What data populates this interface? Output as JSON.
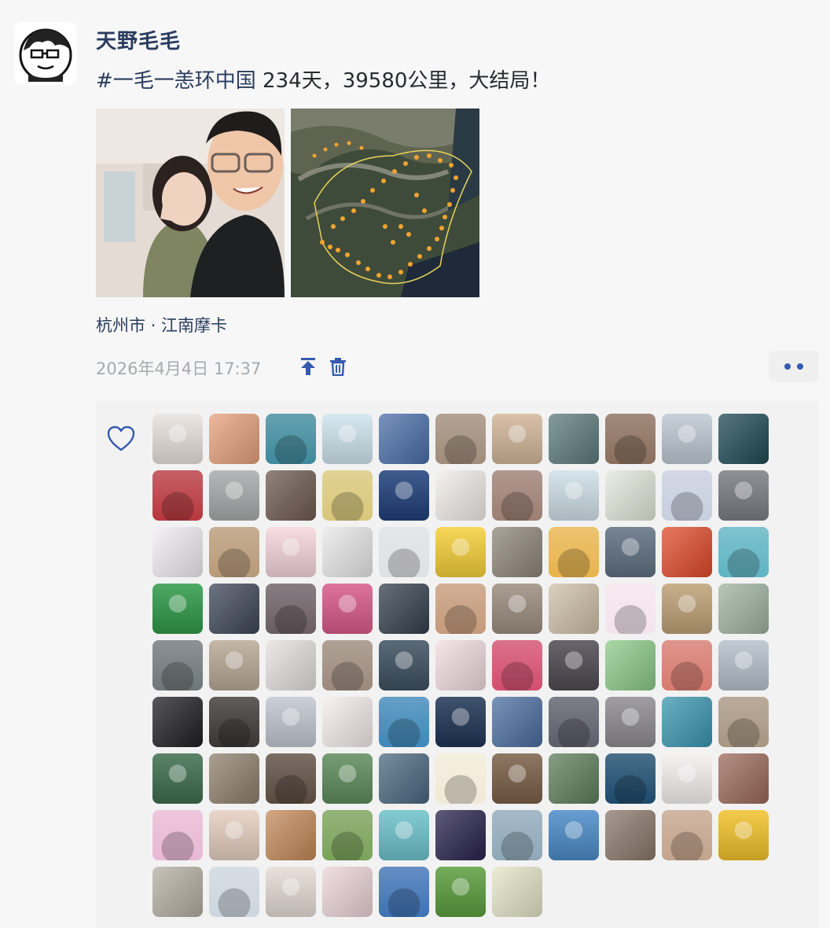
{
  "post": {
    "author": "天野毛毛",
    "hashtag": "#一毛一恙环中国",
    "text": " 234天，39580公里，大结局！",
    "location": "杭州市 · 江南摩卡",
    "timestamp": "2026年4月4日 17:37"
  },
  "actions": {
    "pin_icon": "pin-top-icon",
    "delete_icon": "trash-icon",
    "more_icon": "more-dots-icon"
  },
  "likes": {
    "heart_icon": "heart-outline-icon",
    "avatars": [
      "#E9E2DE",
      "#E6A07C",
      "#3E8A9C",
      "#CFE4EE",
      "#4A6FA8",
      "#A08C7A",
      "#D2B79A",
      "#5C7A7C",
      "#8A6E5C",
      "#BFC9D4",
      "#1E4A55",
      "#B7383E",
      "#A9ACAC",
      "#6E5A4E",
      "#D9C77A",
      "#1F3F7A",
      "#F2EDEA",
      "#9C7E72",
      "#CFE0E8",
      "#E4E8DA",
      "#C7CFDF",
      "#7A7F86",
      "#F0EEF3",
      "#B89A78",
      "#F6D6DE",
      "#E9E9E9",
      "#DFE0E2",
      "#F5D03C",
      "#8E8576",
      "#E8B44C",
      "#5F7082",
      "#E04A2A",
      "#5FB4C4",
      "#2F9A48",
      "#3D4658",
      "#6A5D62",
      "#D85A8A",
      "#34404C",
      "#C59A7A",
      "#9C8E80",
      "#CFC0A8",
      "#F4E4EC",
      "#BFA278",
      "#A0B4A0",
      "#6F767A",
      "#B9AA98",
      "#E4E0DF",
      "#9C8A7C",
      "#3E5060",
      "#F2DCE2",
      "#D24E6E",
      "#4E4A52",
      "#8CCB88",
      "#D67A6E",
      "#B7C2CC",
      "#1F1F24",
      "#3A3434",
      "#C1C7D2",
      "#F4ECEC",
      "#3F88B8",
      "#1E3454",
      "#4B6EA0",
      "#5C5E6A",
      "#8E8C92",
      "#3A96B0",
      "#A89682",
      "#3E6E4E",
      "#8F7F6C",
      "#5A4A3E",
      "#5E8C5C",
      "#4A6880",
      "#F2EAD8",
      "#7A6048",
      "#5E7E5C",
      "#1C4A6C",
      "#F6F1EE",
      "#9C6A5A",
      "#E8B8D4",
      "#E6CFC2",
      "#C48A5A",
      "#7AA25A",
      "#6EC2CC",
      "#28224C",
      "#8FA8B8",
      "#4C8CC8",
      "#8A786A",
      "#C4A48C",
      "#F2C22C",
      "#B4AFA2",
      "#CDD5DE",
      "#E6DCD6",
      "#ECD4D8",
      "#3E72B4",
      "#5C9E3E",
      "#E3E6C8"
    ]
  }
}
